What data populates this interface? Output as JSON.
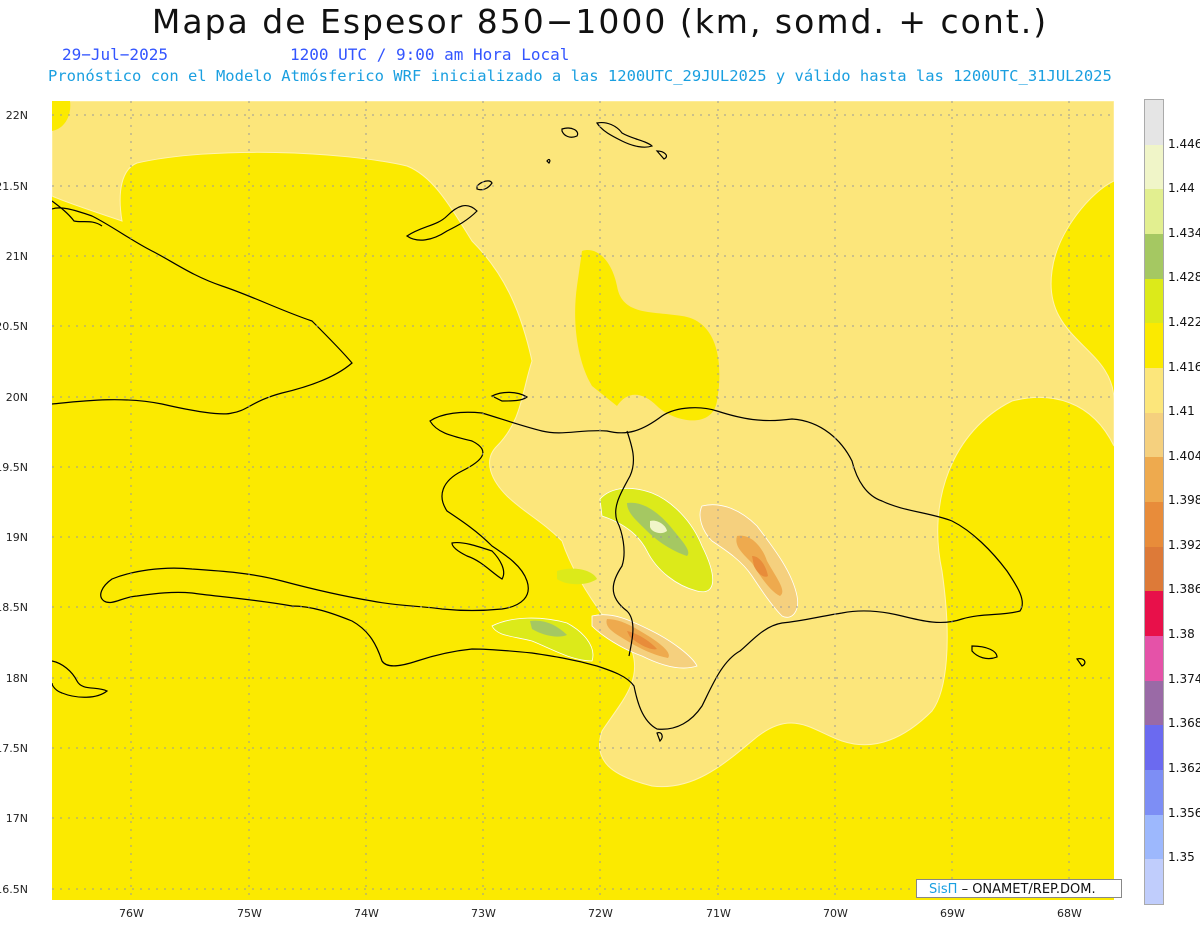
{
  "title": "Mapa de Espesor 850−1000 (km, somd. + cont.)",
  "date": "29−Jul−2025",
  "time": "1200 UTC / 9:00 am Hora Local",
  "description": "Pronóstico con el Modelo Atmósferico WRF inicializado a las 1200UTC_29JUL2025 y válido hasta las  1200UTC_31JUL2025",
  "lat_labels": [
    "22N",
    "21.5N",
    "21N",
    "20.5N",
    "20N",
    "19.5N",
    "19N",
    "18.5N",
    "18N",
    "17.5N",
    "17N",
    "16.5N"
  ],
  "lon_labels": [
    "76W",
    "75W",
    "74W",
    "73W",
    "72W",
    "71W",
    "70W",
    "69W",
    "68W"
  ],
  "colorbar": {
    "labels": [
      "1.446",
      "1.44",
      "1.434",
      "1.428",
      "1.422",
      "1.416",
      "1.41",
      "1.404",
      "1.398",
      "1.392",
      "1.386",
      "1.38",
      "1.374",
      "1.368",
      "1.362",
      "1.356",
      "1.35"
    ],
    "colors": [
      "#e5e5e5",
      "#f0f5c8",
      "#e2ef90",
      "#a5c862",
      "#dcea1a",
      "#fbea00",
      "#fce67b",
      "#f5d07e",
      "#eeaa4e",
      "#e88c3a",
      "#dd7a38",
      "#e8104a",
      "#e552a8",
      "#9a6aa6",
      "#6b6af0",
      "#7d8ef5",
      "#9db8fd",
      "#c0cdfc"
    ]
  },
  "credit": {
    "brand": "SisΠ",
    "text": "– ONAMET/REP.DOM."
  },
  "colors": {
    "background_field": "#fbea00",
    "light_field": "#fce67b"
  }
}
